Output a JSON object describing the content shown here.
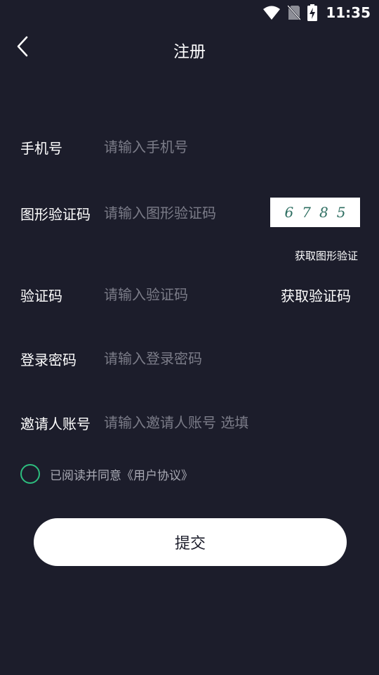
{
  "status_bar": {
    "time": "11:35",
    "icons": [
      "wifi-icon",
      "no-sim-icon",
      "battery-charging-icon"
    ]
  },
  "header": {
    "title": "注册",
    "back_icon": "chevron-left-icon"
  },
  "form": {
    "phone": {
      "label": "手机号",
      "placeholder": "请输入手机号",
      "value": ""
    },
    "captcha": {
      "label": "图形验证码",
      "placeholder": "请输入图形验证码",
      "value": "",
      "image_text": "6785",
      "refresh_label": "获取图形验证"
    },
    "sms_code": {
      "label": "验证码",
      "placeholder": "请输入验证码",
      "value": "",
      "get_code_label": "获取验证码"
    },
    "password": {
      "label": "登录密码",
      "placeholder": "请输入登录密码",
      "value": ""
    },
    "inviter": {
      "label": "邀请人账号",
      "placeholder": "请输入邀请人账号 选填",
      "value": ""
    }
  },
  "agreement": {
    "checked": false,
    "prefix": "已阅读并同意",
    "link_text": "《用户协议》"
  },
  "submit": {
    "label": "提交"
  },
  "colors": {
    "background": "#1c1d2b",
    "accent": "#2dbd7e",
    "placeholder": "#7b7c88",
    "captcha_text": "#2f6f62"
  }
}
